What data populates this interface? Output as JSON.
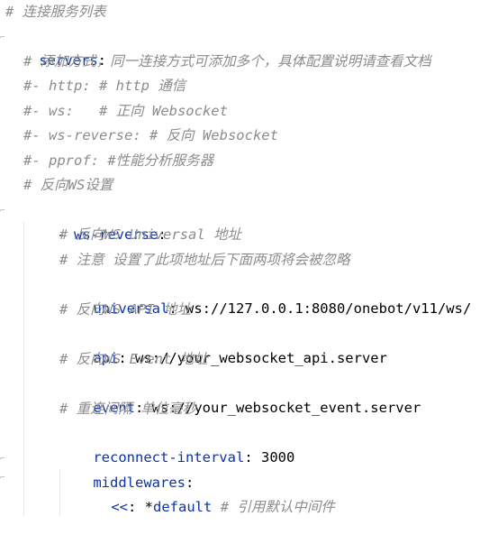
{
  "lines": {
    "l1": "# 连接服务列表",
    "l2_key": "servers",
    "l2_colon": ":",
    "l3": "# 添加方式，同一连接方式可添加多个，具体配置说明请查看文档",
    "l4": "#- http: # http 通信",
    "l5": "#- ws:   # 正向 Websocket",
    "l6": "#- ws-reverse: # 反向 Websocket",
    "l7": "#- pprof: #性能分析服务器",
    "l8": "# 反向WS设置",
    "l9_dash": "- ",
    "l9_key": "ws-reverse",
    "l9_colon": ":",
    "l10": "# 反向WS Universal 地址",
    "l11": "# 注意 设置了此项地址后下面两项将会被忽略",
    "l12_key": "universal",
    "l12_colon": ": ",
    "l12_val": "ws://127.0.0.1:8080/onebot/v11/ws/",
    "l13": "# 反向WS API 地址",
    "l14_key": "api",
    "l14_colon": ": ",
    "l14_val": "ws://your_websocket_api.server",
    "l15": "# 反向WS Event 地址",
    "l16_key": "event",
    "l16_colon": ": ",
    "l16_val": "ws://your_websocket_event.server",
    "l17": "# 重连间隔 单位毫秒",
    "l18_key": "reconnect-interval",
    "l18_colon": ": ",
    "l18_val": "3000",
    "l19_key": "middlewares",
    "l19_colon": ":",
    "l20_key": "<<",
    "l20_colon": ": ",
    "l20_anchor": "*default",
    "l20_comment": "# 引用默认中间件"
  },
  "colors": {
    "comment": "#8c8c8c",
    "key": "#0a33a8",
    "value": "#000000"
  }
}
